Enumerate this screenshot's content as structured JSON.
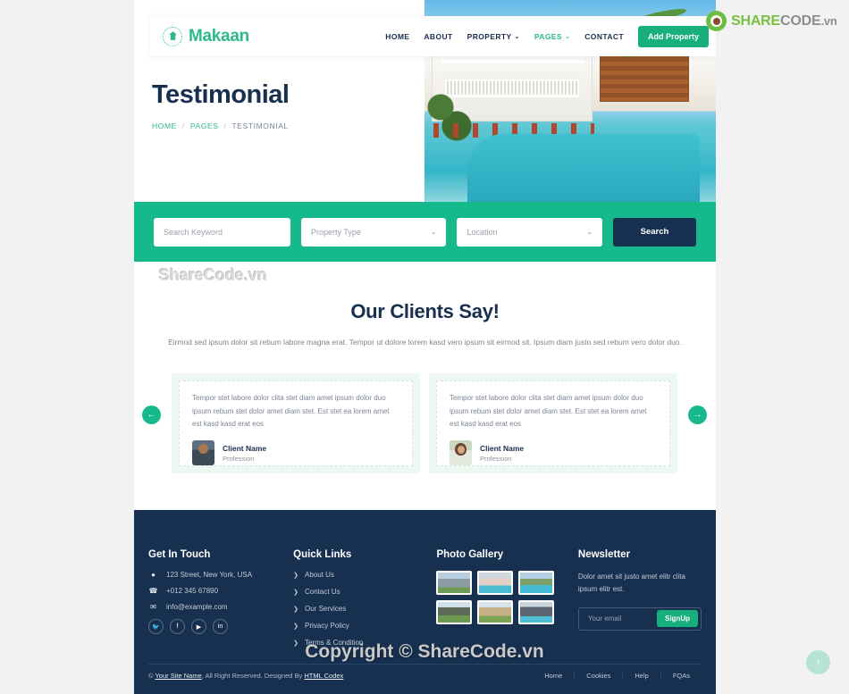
{
  "brand": {
    "name": "Makaan",
    "mark_icon": "house-seal-icon"
  },
  "nav": {
    "items": [
      {
        "label": "HOME",
        "has_caret": false,
        "active": false
      },
      {
        "label": "ABOUT",
        "has_caret": false,
        "active": false
      },
      {
        "label": "PROPERTY",
        "has_caret": true,
        "active": false
      },
      {
        "label": "PAGES",
        "has_caret": true,
        "active": true
      },
      {
        "label": "CONTACT",
        "has_caret": false,
        "active": false
      }
    ],
    "cta": "Add Property",
    "caret_glyph": "⌄"
  },
  "hero": {
    "title": "Testimonial",
    "breadcrumb": [
      {
        "label": "HOME",
        "current": false
      },
      {
        "label": "PAGES",
        "current": false
      },
      {
        "label": "TESTIMONIAL",
        "current": true
      }
    ],
    "separator": "/"
  },
  "search_band": {
    "keyword_placeholder": "Search Keyword",
    "property_type_value": "Property Type",
    "location_value": "Location",
    "search_label": "Search",
    "chevron_glyph": "⌄",
    "bg_color": "#16b98c",
    "button_color": "#17304f"
  },
  "testimonials": {
    "heading": "Our Clients Say!",
    "subtitle": "Eirmod sed ipsum dolor sit rebum labore magna erat. Tempor ut dolore lorem kasd vero ipsum sit eirmod sit. Ipsum diam justo sed rebum vero dolor duo.",
    "prev_glyph": "←",
    "next_glyph": "→",
    "items": [
      {
        "quote": "Tempor stet labore dolor clita stet diam amet ipsum dolor duo ipsum rebum stet dolor amet diam stet. Est stet ea lorem amet est kasd kasd erat eos",
        "name": "Client Name",
        "role": "Profession",
        "avatar": "male-avatar"
      },
      {
        "quote": "Tempor stet labore dolor clita stet diam amet ipsum dolor duo ipsum rebum stet dolor amet diam stet. Est stet ea lorem amet est kasd kasd erat eos",
        "name": "Client Name",
        "role": "Profession",
        "avatar": "female-avatar"
      }
    ]
  },
  "footer": {
    "get_in_touch": {
      "heading": "Get In Touch",
      "address": "123 Street, New York, USA",
      "phone": "+012 345 67890",
      "email": "info@example.com",
      "socials": [
        {
          "name": "twitter-icon",
          "glyph": "🐦"
        },
        {
          "name": "facebook-icon",
          "glyph": "f"
        },
        {
          "name": "youtube-icon",
          "glyph": "▶"
        },
        {
          "name": "linkedin-icon",
          "glyph": "in"
        }
      ]
    },
    "quick_links": {
      "heading": "Quick Links",
      "arrow_glyph": "❯",
      "items": [
        "About Us",
        "Contact Us",
        "Our Services",
        "Privacy Policy",
        "Terms & Condition"
      ]
    },
    "photo_gallery": {
      "heading": "Photo Gallery",
      "thumbs": [
        "house-thumb-1",
        "house-thumb-2",
        "house-thumb-3",
        "house-thumb-4",
        "house-thumb-5",
        "house-thumb-6"
      ]
    },
    "newsletter": {
      "heading": "Newsletter",
      "text": "Dolor amet sit justo amet elitr clita ipsum elitr est.",
      "email_placeholder": "Your email",
      "button": "SignUp"
    },
    "bottom_bar": {
      "copyright_prefix": "© ",
      "site_name": "Your Site Name",
      "copyright_mid": ", All Right Reserved. Designed By ",
      "designer": "HTML Codex",
      "links": [
        "Home",
        "Cookies",
        "Help",
        "FQAs"
      ]
    }
  },
  "back_to_top": {
    "glyph": "↑"
  },
  "watermarks": {
    "logo": {
      "share": "SHARE",
      "code": "CODE",
      "tld": ".vn"
    },
    "mid": "ShareCode.vn",
    "copyright": "Copyright © ShareCode.vn"
  }
}
